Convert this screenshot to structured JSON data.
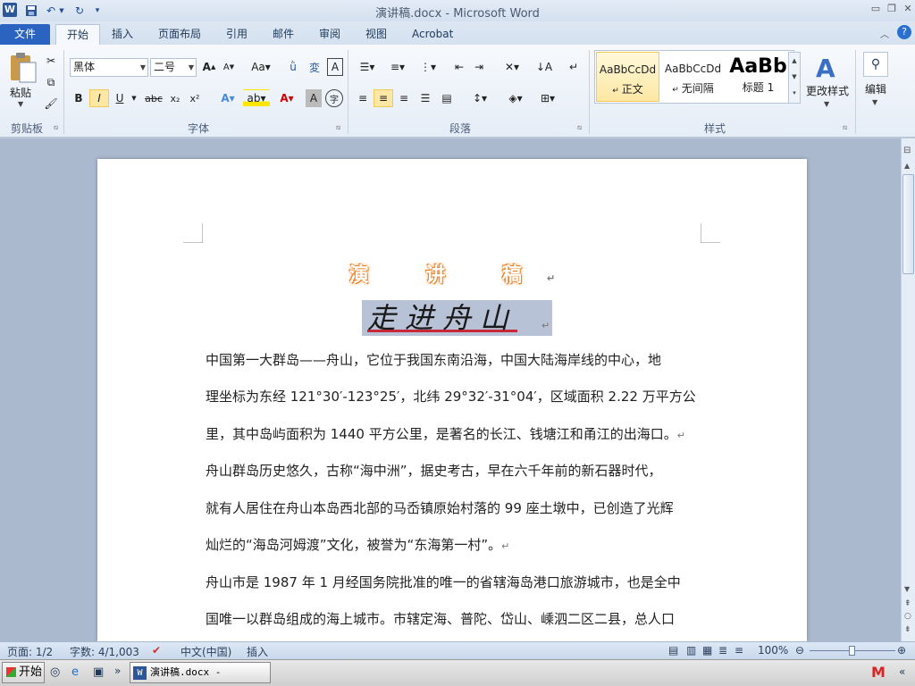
{
  "window": {
    "title": "演讲稿.docx  -  Microsoft Word",
    "app_icon": "W"
  },
  "tabs": [
    "文件",
    "开始",
    "插入",
    "页面布局",
    "引用",
    "邮件",
    "审阅",
    "视图",
    "Acrobat"
  ],
  "active_tab": "开始",
  "ribbon": {
    "clipboard": {
      "paste_label": "粘贴",
      "group_label": "剪贴板"
    },
    "font": {
      "font_name": "黑体",
      "font_size": "二号",
      "group_label": "字体"
    },
    "paragraph": {
      "group_label": "段落"
    },
    "styles": {
      "group_label": "样式",
      "items": [
        {
          "sample": "AaBbCcDd",
          "name": "正文"
        },
        {
          "sample": "AaBbCcDd",
          "name": "无间隔"
        },
        {
          "sample": "AaBb",
          "name": "标题 1"
        }
      ],
      "change_label": "更改样式"
    },
    "editing": {
      "label": "编辑"
    }
  },
  "document": {
    "title": "演 讲 稿",
    "subtitle": "走进舟山",
    "lines": [
      "中国第一大群岛——舟山，它位于我国东南沿海，中国大陆海岸线的中心，地",
      "理坐标为东经 121°30′-123°25′，北纬 29°32′-31°04′，区域面积 2.22 万平方公",
      "里，其中岛屿面积为 1440 平方公里，是著名的长江、钱塘江和甬江的出海口。",
      "舟山群岛历史悠久，古称“海中洲”，据史考古，早在六千年前的新石器时代，",
      "就有人居住在舟山本岛西北部的马岙镇原始村落的 99 座土墩中，已创造了光辉",
      "灿烂的“海岛河姆渡”文化，被誉为“东海第一村”。",
      "舟山市是 1987 年 1 月经国务院批准的唯一的省辖海岛港口旅游城市，也是全中",
      "国唯一以群岛组成的海上城市。市辖定海、普陀、岱山、嵊泗二区二县，总人口"
    ]
  },
  "status": {
    "page": "页面: 1/2",
    "words": "字数: 4/1,003",
    "language": "中文(中国)",
    "mode": "插入",
    "zoom": "100%",
    "zoom_level_percent": 100
  },
  "taskbar": {
    "start": "开始",
    "task": "演讲稿.docx - Micro..."
  },
  "colors": {
    "file_tab": "#2a64c0",
    "ribbon_bg": "#e5edf7",
    "title_glow": "#e87a1e"
  }
}
